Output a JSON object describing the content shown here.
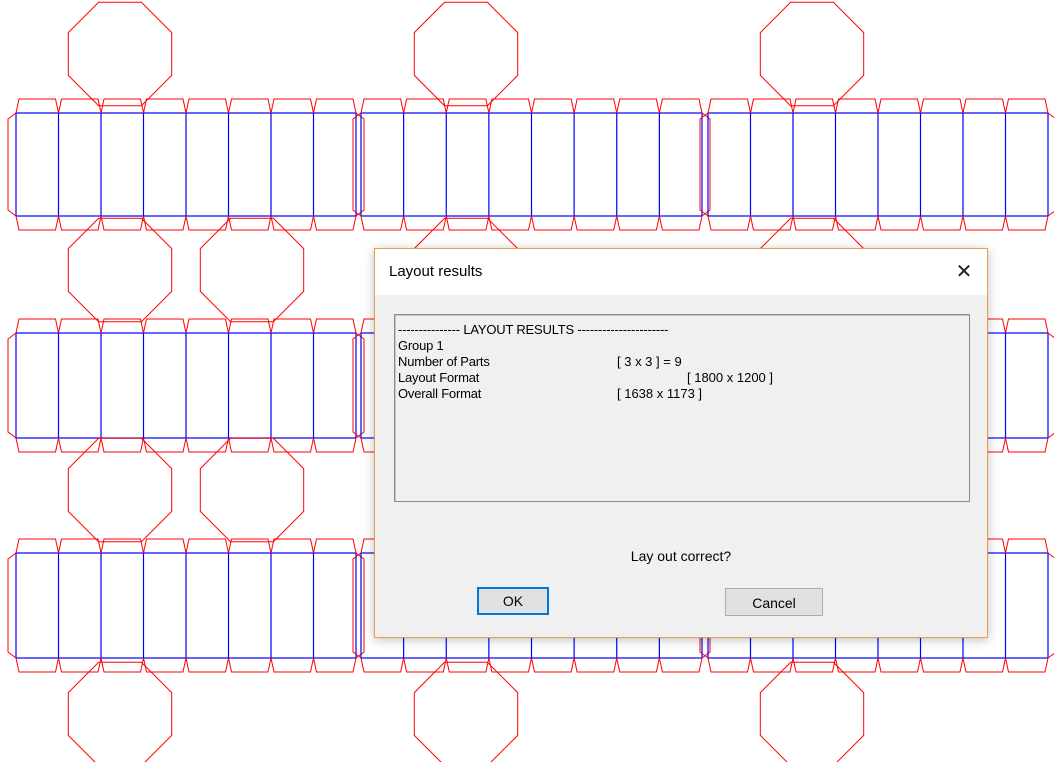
{
  "dialog": {
    "title": "Layout results",
    "close_glyph": "✕",
    "results": {
      "header": "--------------- LAYOUT RESULTS ----------------------",
      "group": "Group 1",
      "rows": [
        {
          "label": "Number of Parts",
          "value": "[ 3 x 3 ] = 9"
        },
        {
          "label": "Layout Format",
          "value": "[ 1800 x 1200 ]"
        },
        {
          "label": "Overall Format",
          "value": "[ 1638 x 1173 ]"
        }
      ]
    },
    "question": "Lay out correct?",
    "ok_label": "OK",
    "cancel_label": "Cancel"
  },
  "colors": {
    "cut_line": "#ff0000",
    "fold_line": "#0000ff",
    "accent": "#0078d7"
  }
}
